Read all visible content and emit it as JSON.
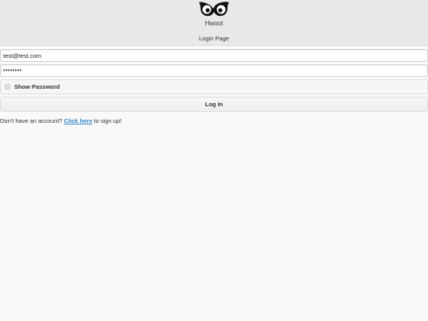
{
  "header": {
    "app_title": "Hwoot",
    "page_title": "Login Page",
    "logo_icon": "owl-eyes-icon"
  },
  "form": {
    "email_value": "test@test.com",
    "password_value": "••••••••",
    "show_password_label": "Show Password",
    "show_password_checked": false,
    "login_label": "Log In"
  },
  "signup": {
    "prefix": "Don't have an account? ",
    "link_text": "Click here",
    "suffix": " to sign up!"
  },
  "colors": {
    "link": "#3388cc",
    "header_bg": "#e9e9e9",
    "page_bg": "#f9f9f9"
  }
}
